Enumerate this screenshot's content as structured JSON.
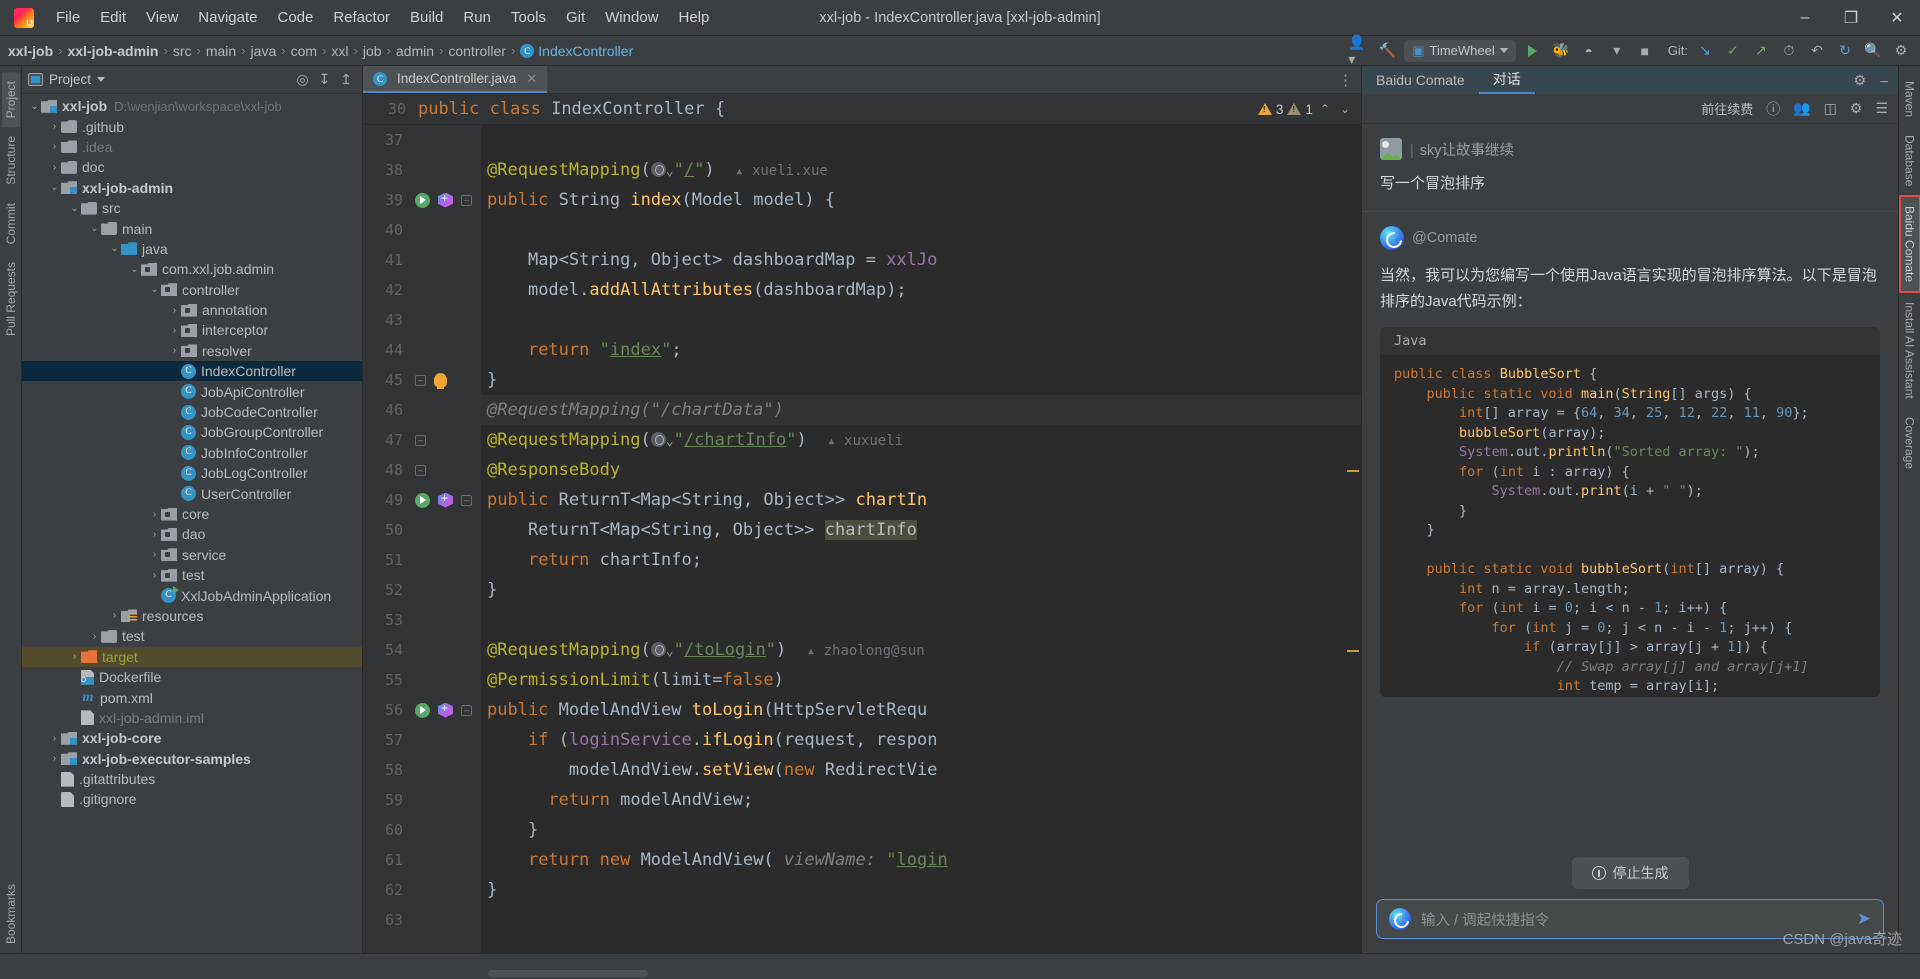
{
  "window": {
    "title": "xxl-job - IndexController.java [xxl-job-admin]",
    "minimize": "–",
    "maximize": "❐",
    "close": "✕"
  },
  "menu": [
    "File",
    "Edit",
    "View",
    "Navigate",
    "Code",
    "Refactor",
    "Build",
    "Run",
    "Tools",
    "Git",
    "Window",
    "Help"
  ],
  "breadcrumb": {
    "items": [
      "xxl-job",
      "xxl-job-admin",
      "src",
      "main",
      "java",
      "com",
      "xxl",
      "job",
      "admin",
      "controller"
    ],
    "current": "IndexController",
    "separator": "›"
  },
  "navbar_right": {
    "profile_icon": "user-icon",
    "build_icon": "hammer-icon",
    "run_config": "TimeWheel",
    "run_icon": "▶",
    "debug_icon": "🐞",
    "coverage_icon": "◴",
    "more_icon": "⋯",
    "stop_icon": "■",
    "git_label": "Git:",
    "git_update": "↓",
    "git_commit": "✓",
    "git_push": "↗",
    "history_icon": "◷",
    "undo_icon": "↶",
    "sync_icon": "↻",
    "search_icon": "🔍",
    "settings_icon": "⚙"
  },
  "left_strip": [
    "Project",
    "Structure",
    "Commit",
    "Pull Requests"
  ],
  "left_strip_bottom": [
    "Bookmarks"
  ],
  "right_strip": [
    "Maven",
    "Database",
    "Baidu Comate",
    "Install AI Assistant",
    "Coverage"
  ],
  "project_panel": {
    "title": "Project",
    "folder_icon": "project-folder-icon",
    "dropdown_icon": "chevron-down-icon",
    "actions": [
      "target-icon",
      "expand-all-icon",
      "collapse-all-icon",
      "settings-icon",
      "hide-icon"
    ],
    "tree": [
      {
        "label": "xxl-job",
        "note": "D:\\wenjian\\workspace\\xxl-job",
        "indent": 0,
        "arrow": "⌄",
        "icon": "f-mod",
        "bold": true
      },
      {
        "label": ".github",
        "note": "",
        "indent": 1,
        "arrow": "›",
        "icon": "f-plain",
        "bold": false
      },
      {
        "label": ".idea",
        "note": "",
        "indent": 1,
        "arrow": "›",
        "icon": "f-plain",
        "bold": false,
        "dim": true
      },
      {
        "label": "doc",
        "note": "",
        "indent": 1,
        "arrow": "›",
        "icon": "f-plain",
        "bold": false
      },
      {
        "label": "xxl-job-admin",
        "note": "",
        "indent": 1,
        "arrow": "⌄",
        "icon": "f-mod",
        "bold": true
      },
      {
        "label": "src",
        "note": "",
        "indent": 2,
        "arrow": "⌄",
        "icon": "f-plain",
        "bold": false
      },
      {
        "label": "main",
        "note": "",
        "indent": 3,
        "arrow": "⌄",
        "icon": "f-plain",
        "bold": false
      },
      {
        "label": "java",
        "note": "",
        "indent": 4,
        "arrow": "⌄",
        "icon": "f-src",
        "bold": false
      },
      {
        "label": "com.xxl.job.admin",
        "note": "",
        "indent": 5,
        "arrow": "⌄",
        "icon": "f-pkg",
        "bold": false
      },
      {
        "label": "controller",
        "note": "",
        "indent": 6,
        "arrow": "⌄",
        "icon": "f-pkg",
        "bold": false
      },
      {
        "label": "annotation",
        "note": "",
        "indent": 7,
        "arrow": "›",
        "icon": "f-pkg",
        "bold": false
      },
      {
        "label": "interceptor",
        "note": "",
        "indent": 7,
        "arrow": "›",
        "icon": "f-pkg",
        "bold": false
      },
      {
        "label": "resolver",
        "note": "",
        "indent": 7,
        "arrow": "›",
        "icon": "f-pkg",
        "bold": false
      },
      {
        "label": "IndexController",
        "note": "",
        "indent": 7,
        "arrow": "",
        "icon": "cicon",
        "bold": false,
        "selected": true
      },
      {
        "label": "JobApiController",
        "note": "",
        "indent": 7,
        "arrow": "",
        "icon": "cicon",
        "bold": false
      },
      {
        "label": "JobCodeController",
        "note": "",
        "indent": 7,
        "arrow": "",
        "icon": "cicon",
        "bold": false
      },
      {
        "label": "JobGroupController",
        "note": "",
        "indent": 7,
        "arrow": "",
        "icon": "cicon",
        "bold": false
      },
      {
        "label": "JobInfoController",
        "note": "",
        "indent": 7,
        "arrow": "",
        "icon": "cicon",
        "bold": false
      },
      {
        "label": "JobLogController",
        "note": "",
        "indent": 7,
        "arrow": "",
        "icon": "cicon",
        "bold": false
      },
      {
        "label": "UserController",
        "note": "",
        "indent": 7,
        "arrow": "",
        "icon": "cicon",
        "bold": false
      },
      {
        "label": "core",
        "note": "",
        "indent": 6,
        "arrow": "›",
        "icon": "f-pkg",
        "bold": false
      },
      {
        "label": "dao",
        "note": "",
        "indent": 6,
        "arrow": "›",
        "icon": "f-pkg",
        "bold": false
      },
      {
        "label": "service",
        "note": "",
        "indent": 6,
        "arrow": "›",
        "icon": "f-pkg",
        "bold": false
      },
      {
        "label": "test",
        "note": "",
        "indent": 6,
        "arrow": "›",
        "icon": "f-pkg",
        "bold": false
      },
      {
        "label": "XxlJobAdminApplication",
        "note": "",
        "indent": 6,
        "arrow": "",
        "icon": "cicon-spring",
        "bold": false
      },
      {
        "label": "resources",
        "note": "",
        "indent": 4,
        "arrow": "›",
        "icon": "f-res",
        "bold": false
      },
      {
        "label": "test",
        "note": "",
        "indent": 3,
        "arrow": "›",
        "icon": "f-plain",
        "bold": false
      },
      {
        "label": "target",
        "note": "",
        "indent": 2,
        "arrow": "›",
        "icon": "f-target",
        "bold": false,
        "green": true,
        "selTarget": true
      },
      {
        "label": "Dockerfile",
        "note": "",
        "indent": 2,
        "arrow": "",
        "icon": "file-docker",
        "bold": false
      },
      {
        "label": "pom.xml",
        "note": "",
        "indent": 2,
        "arrow": "",
        "icon": "maven",
        "bold": false
      },
      {
        "label": "xxl-job-admin.iml",
        "note": "",
        "indent": 2,
        "arrow": "",
        "icon": "file-plain",
        "bold": false,
        "dim": true
      },
      {
        "label": "xxl-job-core",
        "note": "",
        "indent": 1,
        "arrow": "›",
        "icon": "f-mod",
        "bold": true
      },
      {
        "label": "xxl-job-executor-samples",
        "note": "",
        "indent": 1,
        "arrow": "›",
        "icon": "f-mod",
        "bold": true
      },
      {
        "label": ".gitattributes",
        "note": "",
        "indent": 1,
        "arrow": "",
        "icon": "file-plain",
        "bold": false
      },
      {
        "label": ".gitignore",
        "note": "",
        "indent": 1,
        "arrow": "",
        "icon": "file-plain",
        "bold": false
      }
    ]
  },
  "editor": {
    "tab_label": "IndexController.java",
    "tab_icon": "java-class-icon",
    "tab_close": "✕",
    "options_icon": "⋮",
    "sticky_line_number": "30",
    "sticky_code_kw": "public class",
    "sticky_code_name": "IndexController",
    "sticky_code_brace": "{",
    "warn_count": "3",
    "weak_warn_count": "1",
    "nav_up": "⌃",
    "nav_down": "⌄",
    "lines": [
      {
        "n": "37",
        "icons": [],
        "html": ""
      },
      {
        "n": "38",
        "icons": [],
        "html": "annotation-requestmapping-root"
      },
      {
        "n": "39",
        "icons": [
          "run",
          "spring",
          "fold"
        ],
        "html": "public-string-index"
      },
      {
        "n": "40",
        "icons": [],
        "html": ""
      },
      {
        "n": "41",
        "icons": [],
        "html": "map-dashboard"
      },
      {
        "n": "42",
        "icons": [],
        "html": "model-addallattributes"
      },
      {
        "n": "43",
        "icons": [],
        "html": ""
      },
      {
        "n": "44",
        "icons": [],
        "html": "return-index"
      },
      {
        "n": "45",
        "icons": [
          "fold-up",
          "bulb"
        ],
        "html": "closing-brace"
      },
      {
        "n": "46",
        "icons": [],
        "html": "comment-chartdata",
        "highlight": true
      },
      {
        "n": "47",
        "icons": [
          "fold"
        ],
        "html": "annotation-chartinfo"
      },
      {
        "n": "48",
        "icons": [
          "fold-up"
        ],
        "html": "annotation-responsebody"
      },
      {
        "n": "49",
        "icons": [
          "run",
          "spring",
          "fold"
        ],
        "html": "public-returnt-chartinfo"
      },
      {
        "n": "50",
        "icons": [],
        "html": "returnt-chartinfo-assign"
      },
      {
        "n": "51",
        "icons": [],
        "html": "return-chartinfo"
      },
      {
        "n": "52",
        "icons": [],
        "html": "closing-brace2"
      },
      {
        "n": "53",
        "icons": [],
        "html": ""
      },
      {
        "n": "54",
        "icons": [],
        "html": "annotation-tologin"
      },
      {
        "n": "55",
        "icons": [],
        "html": "annotation-permissionlimit"
      },
      {
        "n": "56",
        "icons": [
          "run",
          "spring",
          "fold"
        ],
        "html": "public-modelandview-tologin"
      },
      {
        "n": "57",
        "icons": [],
        "html": "if-loginservice"
      },
      {
        "n": "58",
        "icons": [],
        "html": "modelandview-setview"
      },
      {
        "n": "59",
        "icons": [],
        "html": "return-modelandview"
      },
      {
        "n": "60",
        "icons": [],
        "html": "closing-brace3"
      },
      {
        "n": "61",
        "icons": [],
        "html": "return-new-modelandview"
      },
      {
        "n": "62",
        "icons": [],
        "html": "closing-brace4"
      },
      {
        "n": "63",
        "icons": [],
        "html": ""
      }
    ],
    "authors": {
      "line38": "xueli.xue",
      "line47": "xuxueli",
      "line54": "zhaolong@sun"
    }
  },
  "comate": {
    "tab_title": "Baidu Comate",
    "tab_chat": "对话",
    "settings_icon": "⚙",
    "minimize_icon": "–",
    "toolbar": {
      "renew": "前往续费",
      "help_icon": "?",
      "invite_icon": "user-plus-icon",
      "layout_icon": "layout-icon",
      "gear_icon": "⚙",
      "menu_icon": "☰"
    },
    "user_message": {
      "name": "sky让故事继续",
      "bar": "|",
      "text": "写一个冒泡排序"
    },
    "bot_message": {
      "name": "@Comate",
      "paragraph": "当然，我可以为您编写一个使用Java语言实现的冒泡排序算法。以下是冒泡排序的Java代码示例：",
      "code_lang": "Java"
    },
    "stop_button": "停止生成",
    "input_placeholder": "输入 / 调起快捷指令",
    "send_icon": "➤"
  },
  "statusbar": {
    "watermark": "CSDN @java奇迹"
  }
}
